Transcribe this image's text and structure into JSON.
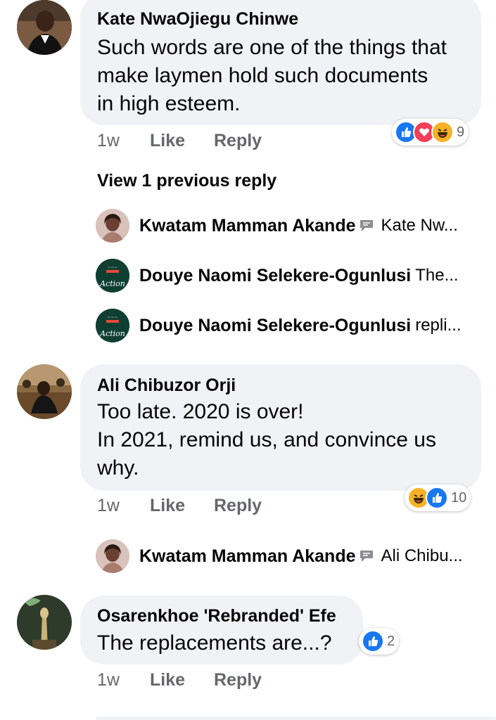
{
  "comments": [
    {
      "author": "Kate NwaOjiegu Chinwe",
      "text": "Such words are one of the things that\nmake laymen hold such documents\nin high esteem.",
      "time": "1w",
      "like_label": "Like",
      "reply_label": "Reply",
      "reaction_count": "9",
      "reactions": [
        "like-icon",
        "love-icon",
        "haha-icon"
      ],
      "view_previous": "View 1 previous reply",
      "replies": [
        {
          "author": "Kwatam Mamman Akande",
          "snippet": "Kate Nw...",
          "has_chat_icon": true
        },
        {
          "author": "Douye Naomi Selekere-Ogunlusi",
          "snippet": "The..."
        },
        {
          "author": "Douye Naomi Selekere-Ogunlusi",
          "snippet": "repli..."
        }
      ]
    },
    {
      "author": "Ali Chibuzor Orji",
      "text": "Too late. 2020 is over!\nIn 2021, remind us, and convince us\nwhy.",
      "time": "1w",
      "like_label": "Like",
      "reply_label": "Reply",
      "reaction_count": "10",
      "reactions": [
        "haha-icon",
        "like-icon"
      ],
      "replies": [
        {
          "author": "Kwatam Mamman Akande",
          "snippet": "Ali Chibu...",
          "has_chat_icon": true
        }
      ]
    },
    {
      "author": "Osarenkhoe 'Rebranded' Efe",
      "text": "The replacements are...?",
      "time": "1w",
      "like_label": "Like",
      "reply_label": "Reply",
      "reaction_count": "2",
      "reactions": [
        "like-icon"
      ]
    }
  ],
  "avatar_text": {
    "douye": "Action"
  },
  "colors": {
    "bubble": "#f0f2f5",
    "meta": "#65676b",
    "like": "#1877f2",
    "love": "#f33e58",
    "haha": "#f7b125"
  }
}
